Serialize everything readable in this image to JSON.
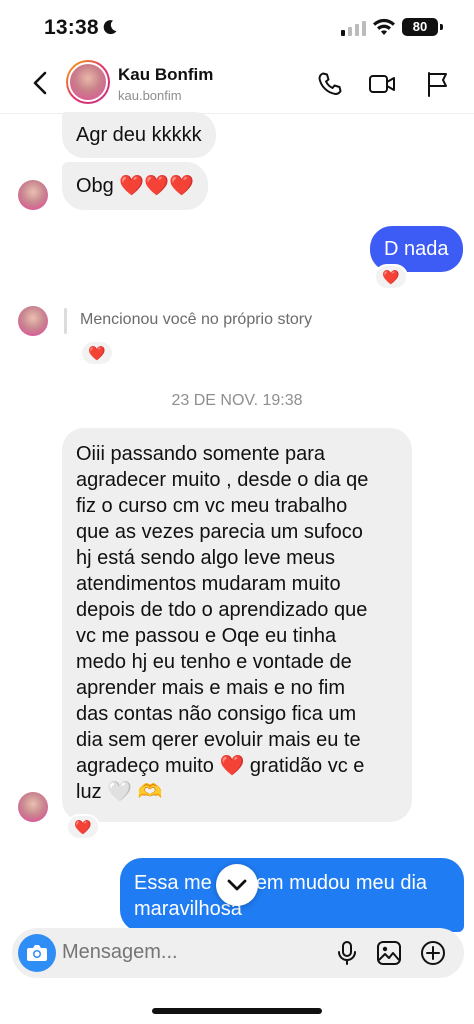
{
  "status_bar": {
    "time": "13:38",
    "battery": "80"
  },
  "header": {
    "name": "Kau Bonfim",
    "username": "kau.bonfim"
  },
  "messages": {
    "m1": "Agr deu kkkkk",
    "m2_text": "Obg",
    "m2_hearts": "❤️❤️❤️",
    "m3": "D nada",
    "m3_reaction": "❤️",
    "story_mention": "Mencionou você no próprio story",
    "story_reaction": "❤️",
    "date": "23 DE NOV. 19:38",
    "long_lines": [
      "Oiii passando somente para",
      "agradecer muito , desde o dia qe",
      "fiz o curso cm vc meu trabalho",
      "que as vezes parecia um sufoco",
      "hj está sendo algo leve meus",
      "atendimentos mudaram muito",
      "depois de tdo o aprendizado que",
      "vc me passou e Oqe eu tinha",
      "medo hj eu tenho e vontade de",
      "aprender mais e mais e no fim",
      "das contas não consigo fica um",
      "dia sem qerer evoluir mais eu te"
    ],
    "long_line13_a": "agradeço muito",
    "long_line13_heart": "❤️",
    "long_line13_b": "gratidão vc e",
    "long_line14": "luz",
    "long_line14_emoji_white": "🤍",
    "long_line14_emoji_hands": "🫶",
    "long_reaction": "❤️",
    "out_line1_a": "Essa me",
    "out_line1_b": "em mudou meu dia",
    "out_line2": "maravilhosa"
  },
  "composer": {
    "placeholder": "Mensagem..."
  },
  "colors": {
    "outgoing": "#3d5bf5",
    "incoming": "#efefef",
    "accent": "#2e8ef5"
  },
  "icons": [
    "moon-icon",
    "signal-icon",
    "wifi-icon",
    "back-arrow-icon",
    "phone-icon",
    "video-icon",
    "flag-icon",
    "chevron-down-icon",
    "camera-icon",
    "mic-icon",
    "image-icon",
    "plus-icon"
  ]
}
